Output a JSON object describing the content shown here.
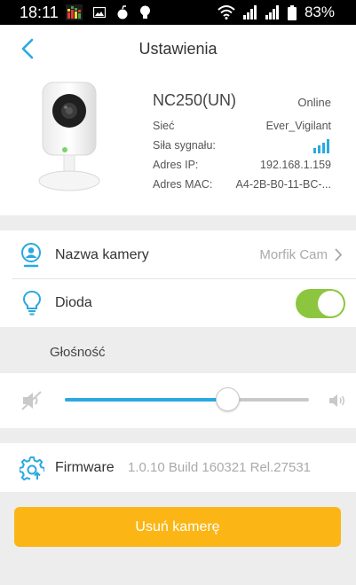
{
  "status_bar": {
    "time": "18:11",
    "battery": "83%"
  },
  "header": {
    "title": "Ustawienia"
  },
  "camera": {
    "model": "NC250(UN)",
    "status": "Online",
    "info": [
      {
        "label": "Sieć",
        "value": "Ever_Vigilant"
      },
      {
        "label": "Siła sygnału:",
        "value": ""
      },
      {
        "label": "Adres IP:",
        "value": "192.168.1.159"
      },
      {
        "label": "Adres MAC:",
        "value": "A4-2B-B0-11-BC-..."
      }
    ]
  },
  "settings": {
    "camera_name": {
      "label": "Nazwa kamery",
      "value": "Morfik Cam"
    },
    "led": {
      "label": "Dioda",
      "enabled": true
    }
  },
  "volume": {
    "label": "Głośność",
    "level_percent": 66
  },
  "firmware": {
    "label": "Firmware",
    "value": "1.0.10 Build 160321 Rel.27531"
  },
  "actions": {
    "remove_label": "Usuń kamerę"
  },
  "colors": {
    "accent": "#29a9e0",
    "toggle_on": "#8cc63f",
    "remove_button": "#fbb616"
  }
}
